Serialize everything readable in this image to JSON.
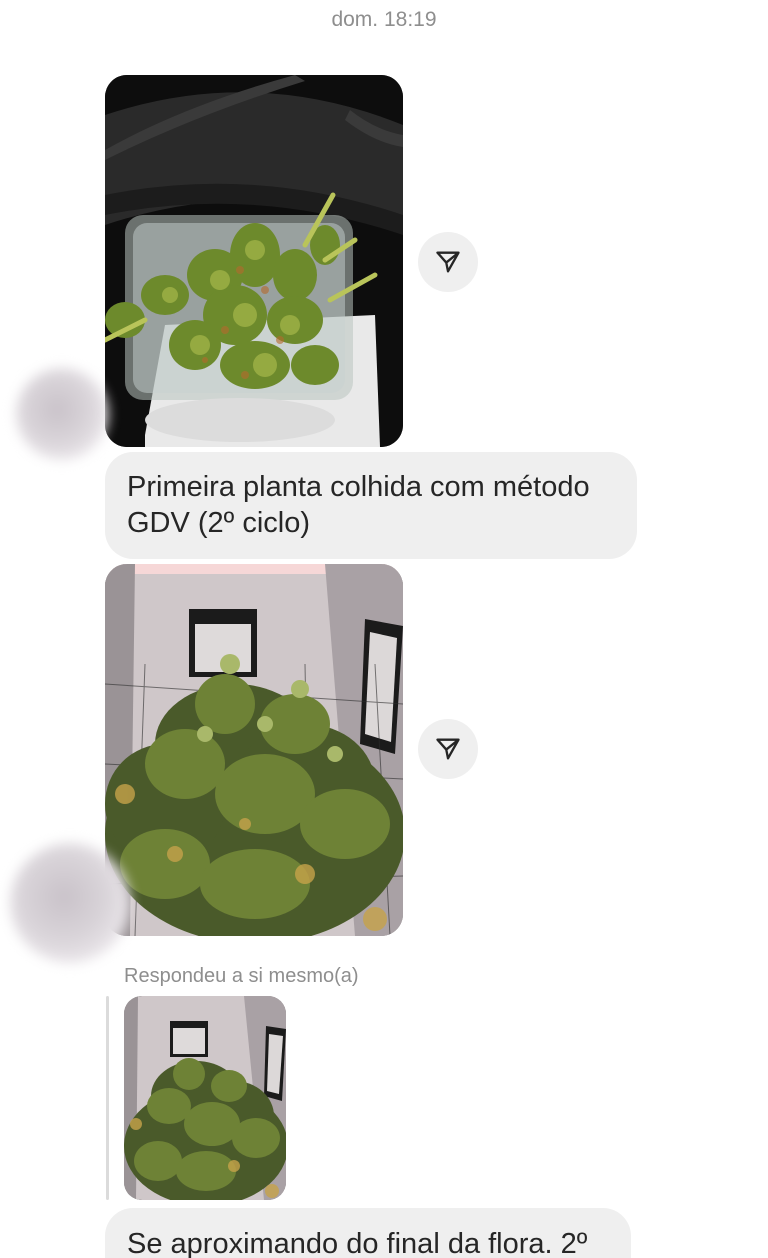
{
  "thread": {
    "timestamp": "dom. 18:19"
  },
  "messages": [
    {
      "type": "photo",
      "image": "harvested-buds-in-glass-container",
      "icon": "send-icon"
    },
    {
      "type": "text",
      "text": "Primeira planta colhida com método GDV (2º ciclo)"
    },
    {
      "type": "photo",
      "image": "grow-tent-flowering-plants",
      "icon": "send-icon"
    },
    {
      "type": "reply",
      "label": "Respondeu a si mesmo(a)",
      "image": "grow-tent-flowering-plants-thumbnail"
    },
    {
      "type": "text",
      "text": "Se aproximando do final da flora. 2º"
    }
  ],
  "colors": {
    "bubble": "#efefef",
    "text": "#262626",
    "muted": "#8e8e8e"
  }
}
